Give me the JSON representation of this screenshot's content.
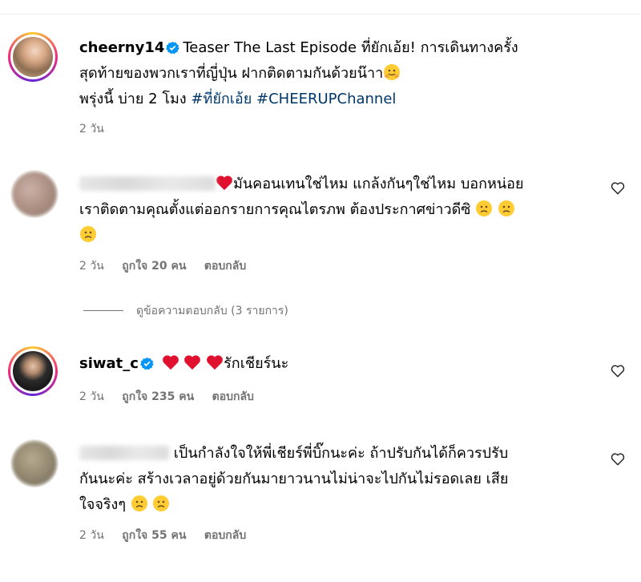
{
  "post": {
    "username": "cheerny14",
    "caption_line1": "Teaser The Last Episode ที่ยักเอ้ย! การเดินทางครั้ง",
    "caption_line2": "สุดท้ายของพวกเราที่ญี่ปุ่น ฝากติดตามกันด้วยน๊าา",
    "caption_line3": "พรุ่งนี้ บ่าย 2 โมง",
    "hashtag1": "#ที่ยักเอ้ย",
    "hashtag2": "#CHEERUPChannel",
    "time": "2 วัน"
  },
  "comments": [
    {
      "line1": "มันคอนเทนใช่ไหม แกล้งกันๆใช่ไหม บอกหน่อย",
      "line2": "เราติดตามคุณตั้งแต่ออกรายการคุณไตรภพ ต้องประกาศข่าวดีซิ",
      "time": "2 วัน",
      "likes": "ถูกใจ 20 คน",
      "reply": "ตอบกลับ",
      "view_replies": "ดูข้อความตอบกลับ (3 รายการ)"
    },
    {
      "username": "siwat_c",
      "text": "รักเชียร์นะ",
      "time": "2 วัน",
      "likes": "ถูกใจ 235 คน",
      "reply": "ตอบกลับ"
    },
    {
      "line1": "เป็นกำลังใจให้พี่เชียร์พี่บิ๊กนะค่ะ ถ้าปรับกันได้ก็ควรปรับ",
      "line2": "กันนะค่ะ สร้างเวลาอยู่ด้วยกันมายาวนานไม่น่าจะไปกันไม่รอดเลย เสีย",
      "line3": "ใจจริงๆ",
      "time": "2 วัน",
      "likes": "ถูกใจ 55 คน",
      "reply": "ตอบกลับ"
    }
  ],
  "colors": {
    "verified": "#0095f6",
    "hashtag": "#00376b",
    "meta": "#737373",
    "heart": "#ed4956"
  }
}
